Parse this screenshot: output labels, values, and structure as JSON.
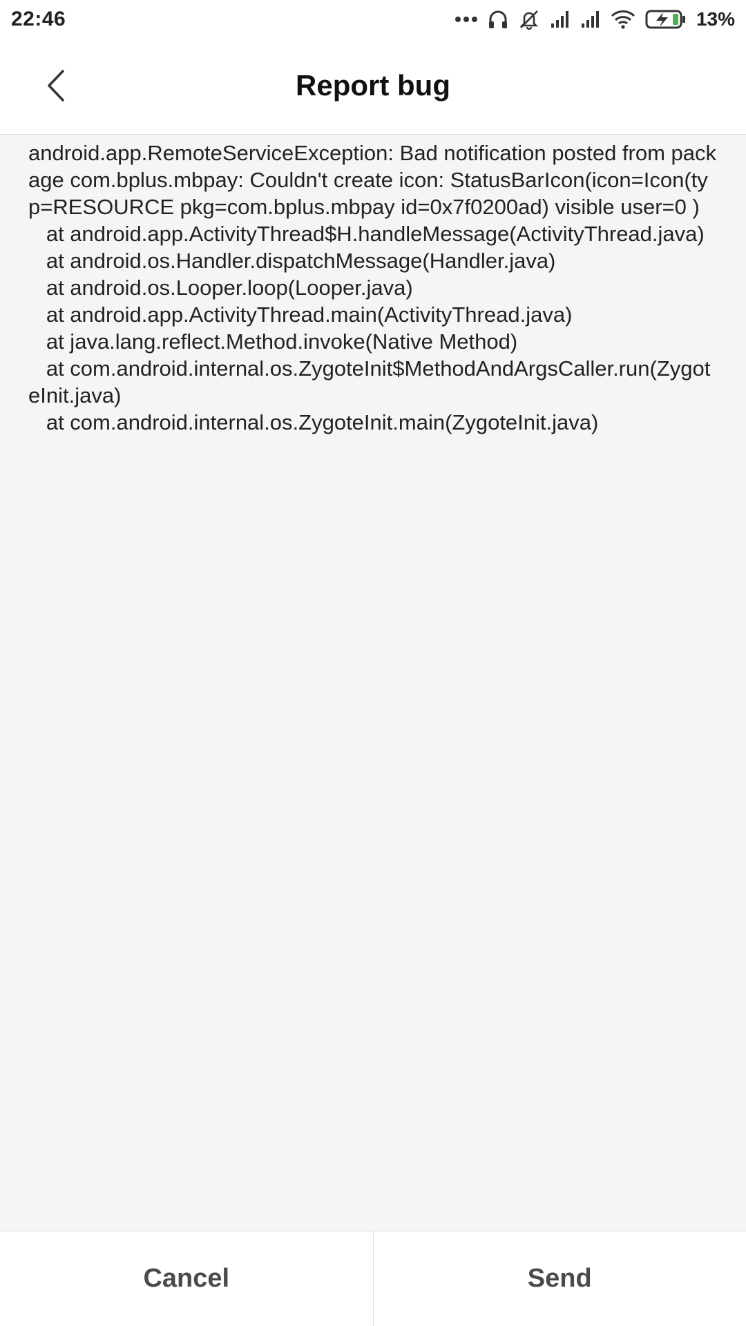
{
  "status_bar": {
    "time": "22:46",
    "icons": [
      "more-dots-icon",
      "headset-icon",
      "muted-bell-icon",
      "signal-icon",
      "signal-icon",
      "wifi-icon",
      "battery-charging-icon"
    ],
    "battery_percent": "13%",
    "battery_color": "#4caf50"
  },
  "header": {
    "back_icon": "chevron-left-icon",
    "title": "Report bug"
  },
  "report": {
    "text": "android.app.RemoteServiceException: Bad notification posted from package com.bplus.mbpay: Couldn't create icon: StatusBarIcon(icon=Icon(typ=RESOURCE pkg=com.bplus.mbpay id=0x7f0200ad) visible user=0 )\n   at android.app.ActivityThread$H.handleMessage(ActivityThread.java)\n   at android.os.Handler.dispatchMessage(Handler.java)\n   at android.os.Looper.loop(Looper.java)\n   at android.app.ActivityThread.main(ActivityThread.java)\n   at java.lang.reflect.Method.invoke(Native Method)\n   at com.android.internal.os.ZygoteInit$MethodAndArgsCaller.run(ZygoteInit.java)\n   at com.android.internal.os.ZygoteInit.main(ZygoteInit.java)"
  },
  "footer": {
    "cancel_label": "Cancel",
    "send_label": "Send"
  }
}
